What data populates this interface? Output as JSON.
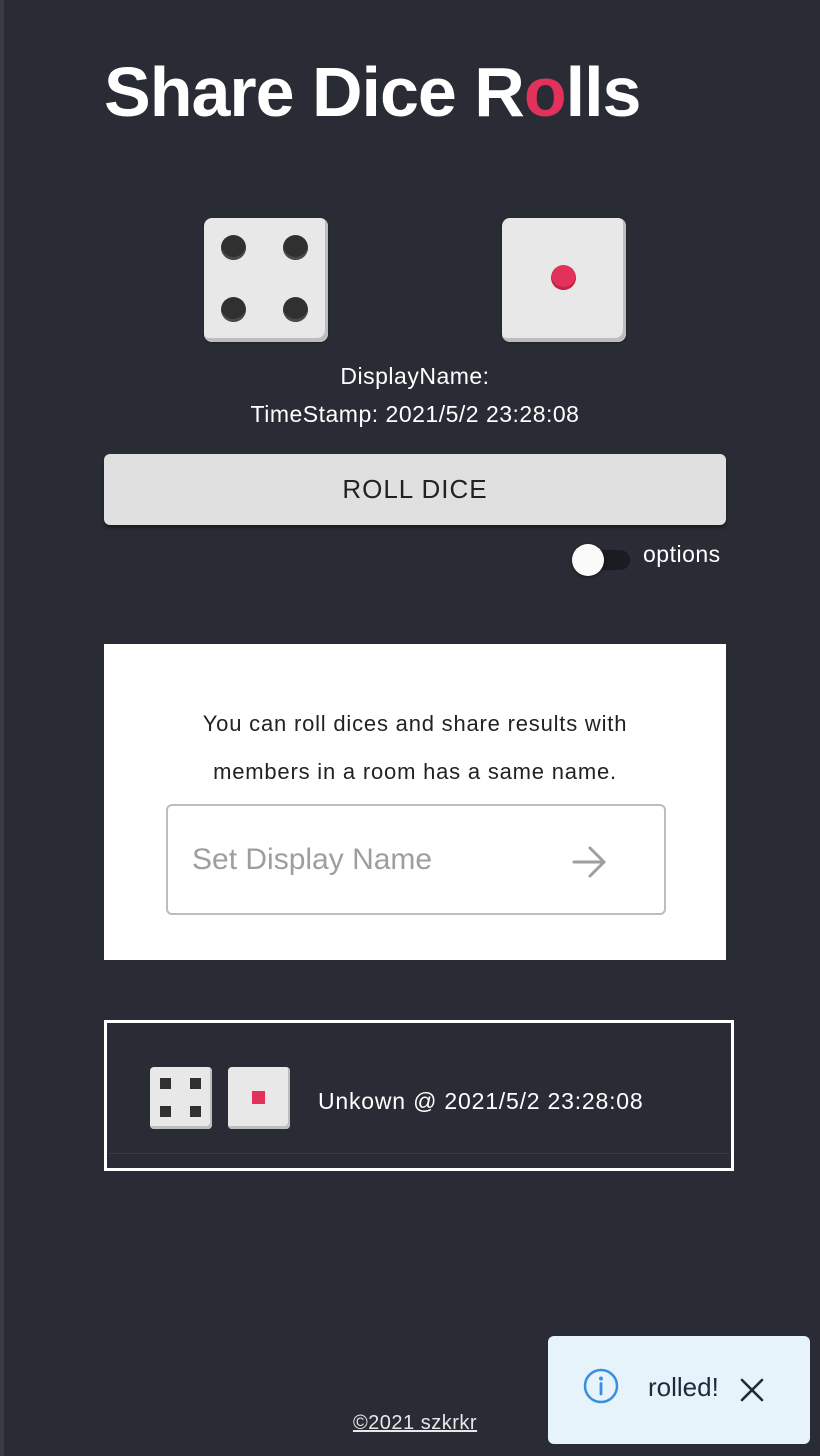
{
  "header": {
    "title_before": "Share Dice R",
    "title_accent": "o",
    "title_after": "lls"
  },
  "dice": [
    {
      "value": 4,
      "color": "#303030"
    },
    {
      "value": 1,
      "color": "#e2325c"
    }
  ],
  "roll_info": {
    "display_name_label": "DisplayName:",
    "timestamp_label": "TimeStamp: 2021/5/2 23:28:08"
  },
  "roll_button_label": "ROLL DICE",
  "options": {
    "label": "options",
    "enabled": false
  },
  "card": {
    "description_line1": "You can roll dices and share results with",
    "description_line2": "members in a room has a same name.",
    "name_placeholder": "Set Display Name"
  },
  "history": [
    {
      "dice": [
        4,
        1
      ],
      "text": "Unkown @ 2021/5/2 23:28:08"
    }
  ],
  "footer": {
    "copyright": "©2021 szkrkr"
  },
  "toast": {
    "message": "rolled!",
    "icon": "info-icon"
  },
  "colors": {
    "background": "#2a2c35",
    "accent": "#e2325c",
    "toast_background": "#e6f3fb",
    "info_blue": "#3a8ee0"
  }
}
